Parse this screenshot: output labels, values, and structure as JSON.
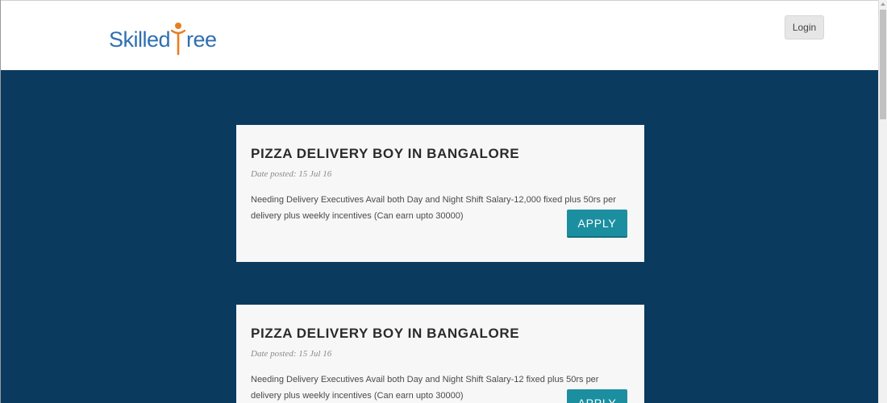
{
  "header": {
    "logo": {
      "text_left": "Skilled",
      "text_right": "ree",
      "mark_icon": "tree-person-icon"
    },
    "login_label": "Login"
  },
  "jobs": [
    {
      "title": "PIZZA DELIVERY BOY IN BANGALORE",
      "date_posted": "Date posted: 15 Jul 16",
      "description": "Needing Delivery Executives Avail both Day and Night Shift Salary-12,000 fixed plus 50rs per delivery plus weekly incentives (Can earn upto 30000)",
      "apply_label": "APPLY"
    },
    {
      "title": "PIZZA DELIVERY BOY IN BANGALORE",
      "date_posted": "Date posted: 15 Jul 16",
      "description": "Needing Delivery Executives Avail both Day and Night Shift Salary-12 fixed plus 50rs per delivery plus weekly incentives (Can earn upto 30000)",
      "apply_label": "APPLY"
    }
  ],
  "colors": {
    "page_background": "#0b3a5f",
    "card_background": "#f7f7f7",
    "apply_button": "#1b8fa0",
    "logo_blue": "#2e6fb2",
    "logo_orange": "#e67e22"
  }
}
